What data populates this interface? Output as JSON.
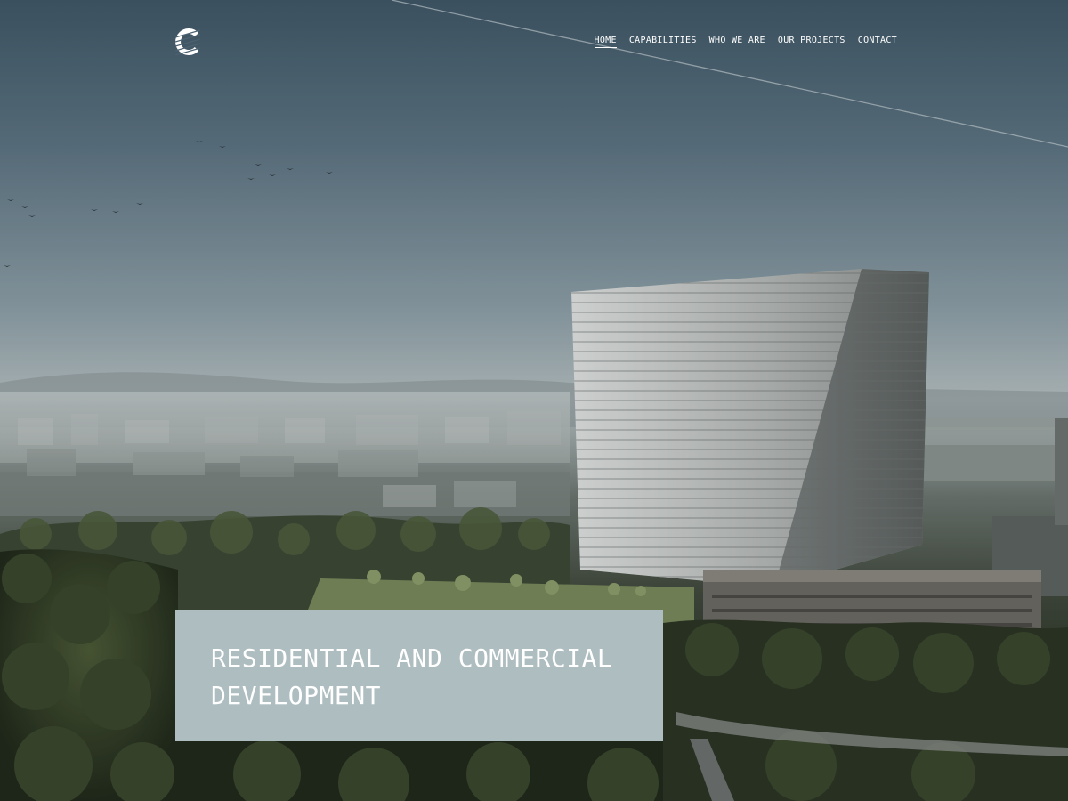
{
  "brand": {
    "logo_icon": "c-striped-logo-icon"
  },
  "nav": {
    "items": [
      {
        "label": "HOME",
        "active": true
      },
      {
        "label": "CAPABILITIES",
        "active": false
      },
      {
        "label": "WHO WE ARE",
        "active": false
      },
      {
        "label": "OUR PROJECTS",
        "active": false
      },
      {
        "label": "CONTACT",
        "active": false
      }
    ]
  },
  "hero": {
    "headline": "RESIDENTIAL AND COMMERCIAL DEVELOPMENT",
    "box_color": "#aebdc0",
    "text_color": "#ffffff"
  }
}
